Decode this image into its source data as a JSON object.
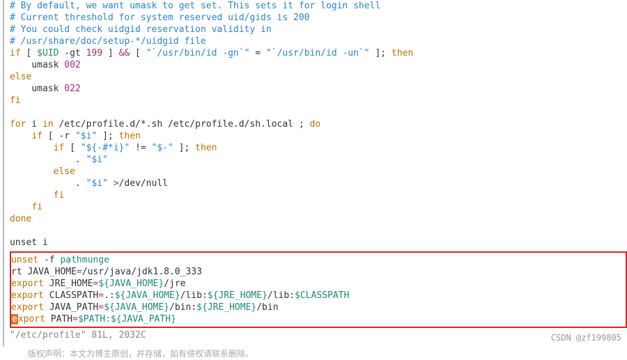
{
  "comments": {
    "c1": "# By default, we want umask to get set. This sets it for login shell",
    "c2": "# Current threshold for system reserved uid/gids is 200",
    "c3": "# You could check uidgid reservation validity in",
    "c4": "# /usr/share/doc/setup-*/uidgid file"
  },
  "kw": {
    "if": "if",
    "then": "then",
    "else": "else",
    "fi": "fi",
    "for": "for",
    "do": "do",
    "in": "in",
    "done": "done",
    "unset": "unset",
    "export": "export"
  },
  "ifline": {
    "lb": " [ ",
    "uid": "$UID",
    "gt": " -gt ",
    "n199": "199",
    "rb": " ] ",
    "and": "&&",
    "lb2": " [ ",
    "q1": "\"`",
    "cmd1": "/usr/bin/id -gn",
    "q2": "`\"",
    "eq": " = ",
    "q3": "\"`",
    "cmd2": "/usr/bin/id -un",
    "q4": "`\"",
    "rb2": " ]; "
  },
  "umask1_pad": "    umask",
  "umask1_n": " 002",
  "umask2_pad": "    umask",
  "umask2_n": " 022",
  "forline": {
    "i": " i ",
    "paths": " /etc/profile.d/*.sh /etc/profile.d/sh.local ; "
  },
  "loop": {
    "if1_pad": "    ",
    "if1_cond_l": " [ -r ",
    "if1_var": "\"$i\"",
    "if1_cond_r": " ]; ",
    "if2_pad": "        ",
    "if2_l": " [ ",
    "if2_str": "\"${-#*i}\"",
    "if2_ne": " != ",
    "if2_r": "\"$-\"",
    "if2_close": " ]; ",
    "dot1_pad": "            . ",
    "dot1_var": "\"$i\"",
    "else_pad": "        ",
    "dot2_pad": "            . ",
    "dot2_var": "\"$i\"",
    "dot2_gt": " >",
    "dot2_null": "/dev/null",
    "fi2_pad": "        ",
    "fi1_pad": "    "
  },
  "unset_i_pad": "unset i",
  "box": {
    "l1_a": "unset",
    "l1_b": " -f ",
    "l1_c": "pathmunge",
    "l2_a": "rt JAVA_HOME",
    "l2_eq": "=",
    "l2_b": "/usr/java/jdk1.8.0_333",
    "l3_a": " JRE_HOME",
    "l3_eq": "=",
    "l3_b": "${JAVA_HOME}",
    "l3_c": "/jre",
    "l4_a": " CLASSPATH",
    "l4_eq": "=",
    "l4_b": ".:",
    "l4_c": "${JAVA_HOME}",
    "l4_d": "/lib:",
    "l4_e": "${JRE_HOME}",
    "l4_f": "/lib:",
    "l4_g": "$CLASSPATH",
    "l5_a": " JAVA_PATH",
    "l5_eq": "=",
    "l5_b": "${JAVA_HOME}",
    "l5_c": "/bin:",
    "l5_d": "${JRE_HOME}",
    "l5_e": "/bin",
    "l6_cur": "e",
    "l6_a": "xport",
    "l6_b": " PATH",
    "l6_eq": "=",
    "l6_c": "$PATH:",
    "l6_d": "${JAVA_PATH}"
  },
  "status": "\"/etc/profile\" 81L, 2032C",
  "footer": "版权声明：本文为博主原创，并存储，如有侵权请联系删除。",
  "watermark": "CSDN @zf199805"
}
